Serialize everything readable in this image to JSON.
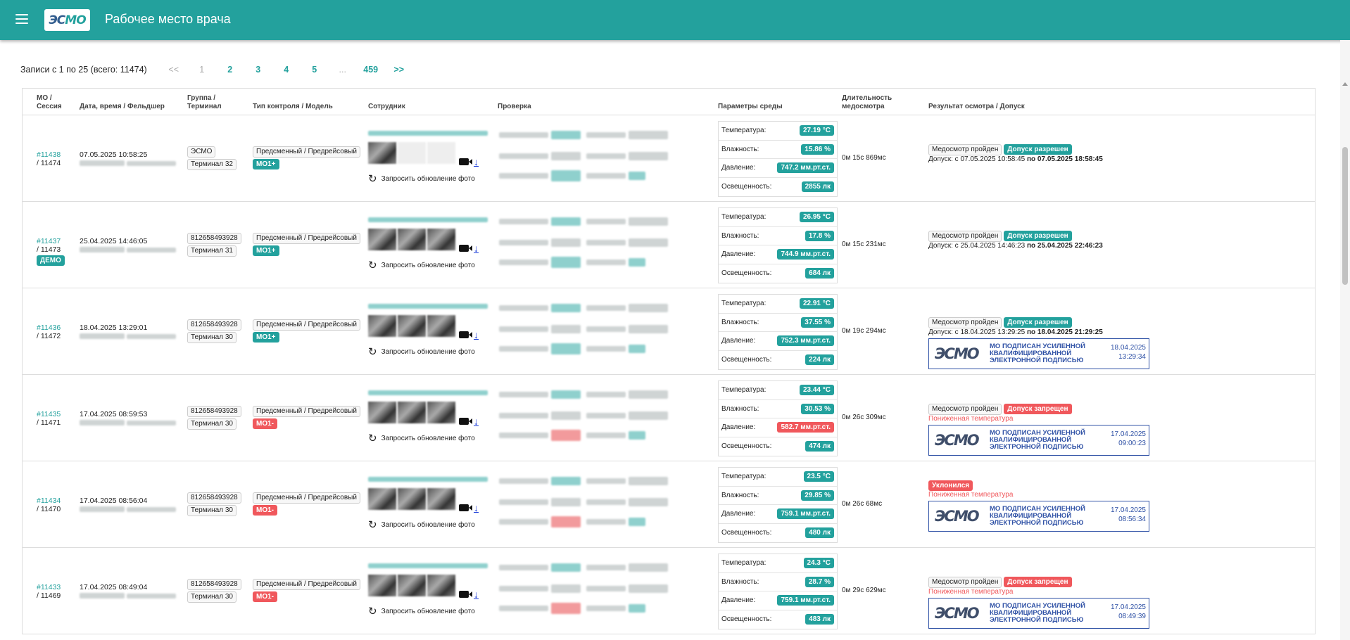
{
  "header": {
    "title": "Рабочее место врача",
    "logo": "ЭСМО"
  },
  "pagination": {
    "summary": "Записи с 1 по 25 (всего: 11474)",
    "prev": "<<",
    "pages": [
      "1",
      "2",
      "3",
      "4",
      "5",
      "...",
      "459"
    ],
    "next": ">>"
  },
  "columns": {
    "mo": "МО /\nСессия",
    "datetime": "Дата, время / Фельдшер",
    "group": "Группа /\nТерминал",
    "type": "Тип контроля / Модель",
    "employee": "Сотрудник",
    "check": "Проверка",
    "env": "Параметры среды",
    "duration": "Длительность\nмедосмотра",
    "result": "Результат осмотра / Допуск"
  },
  "labels": {
    "refresh": "Запросить обновление фото",
    "temp": "Температура:",
    "hum": "Влажность:",
    "press": "Давление:",
    "light": "Освещенность:",
    "stamp_text": "МО ПОДПИСАН УСИЛЕННОЙ КВАЛИФИЦИРОВАННОЙ ЭЛЕКТРОННОЙ ПОДПИСЬЮ"
  },
  "rows": [
    {
      "mo": "#11438",
      "session": "/ 11474",
      "demo": "",
      "datetime": "07.05.2025 10:58:25",
      "group": "ЭСМО",
      "terminal": "Терминал 32",
      "type": "Предсменный / Предрейсовый",
      "model": "МО1+",
      "model_red": false,
      "temp": "27.19 °C",
      "hum": "15.86 %",
      "press": "747.2 мм.рт.ст.",
      "press_red": false,
      "light": "2855 лк",
      "duration": "0м 15с 869мс",
      "status": "Медосмотр пройден",
      "admit": "Допуск разрешен",
      "admit_red": false,
      "reason": "",
      "period_from": "Допуск: с 07.05.2025 10:58:45 ",
      "period_to": "по 07.05.2025 18:58:45",
      "stamp_date": "",
      "stamp_time": ""
    },
    {
      "mo": "#11437",
      "session": "/ 11473",
      "demo": "ДЕМО",
      "datetime": "25.04.2025 14:46:05",
      "group": "812658493928",
      "terminal": "Терминал 31",
      "type": "Предсменный / Предрейсовый",
      "model": "МО1+",
      "model_red": false,
      "temp": "26.95 °C",
      "hum": "17.8 %",
      "press": "744.9 мм.рт.ст.",
      "press_red": false,
      "light": "684 лк",
      "duration": "0м 15с 231мс",
      "status": "Медосмотр пройден",
      "admit": "Допуск разрешен",
      "admit_red": false,
      "reason": "",
      "period_from": "Допуск: с 25.04.2025 14:46:23 ",
      "period_to": "по 25.04.2025 22:46:23",
      "stamp_date": "",
      "stamp_time": ""
    },
    {
      "mo": "#11436",
      "session": "/ 11472",
      "demo": "",
      "datetime": "18.04.2025 13:29:01",
      "group": "812658493928",
      "terminal": "Терминал 30",
      "type": "Предсменный / Предрейсовый",
      "model": "МО1+",
      "model_red": false,
      "temp": "22.91 °C",
      "hum": "37.55 %",
      "press": "752.3 мм.рт.ст.",
      "press_red": false,
      "light": "224 лк",
      "duration": "0м 19с 294мс",
      "status": "Медосмотр пройден",
      "admit": "Допуск разрешен",
      "admit_red": false,
      "reason": "",
      "period_from": "Допуск: с 18.04.2025 13:29:25 ",
      "period_to": "по 18.04.2025 21:29:25",
      "stamp_date": "18.04.2025",
      "stamp_time": "13:29:34"
    },
    {
      "mo": "#11435",
      "session": "/ 11471",
      "demo": "",
      "datetime": "17.04.2025 08:59:53",
      "group": "812658493928",
      "terminal": "Терминал 30",
      "type": "Предсменный / Предрейсовый",
      "model": "МО1-",
      "model_red": true,
      "temp": "23.44 °C",
      "hum": "30.53 %",
      "press": "582.7 мм.рт.ст.",
      "press_red": true,
      "light": "474 лк",
      "duration": "0м 26с 309мс",
      "status": "Медосмотр пройден",
      "admit": "Допуск запрещен",
      "admit_red": true,
      "reason": "Пониженная температура",
      "period_from": "",
      "period_to": "",
      "stamp_date": "17.04.2025",
      "stamp_time": "09:00:23"
    },
    {
      "mo": "#11434",
      "session": "/ 11470",
      "demo": "",
      "datetime": "17.04.2025 08:56:04",
      "group": "812658493928",
      "terminal": "Терминал 30",
      "type": "Предсменный / Предрейсовый",
      "model": "МО1-",
      "model_red": true,
      "temp": "23.5 °C",
      "hum": "29.85 %",
      "press": "759.1 мм.рт.ст.",
      "press_red": false,
      "light": "480 лк",
      "duration": "0м 26с 68мс",
      "status": "",
      "admit": "Уклонился",
      "admit_red": true,
      "reason": "Пониженная температура",
      "period_from": "",
      "period_to": "",
      "stamp_date": "17.04.2025",
      "stamp_time": "08:56:34"
    },
    {
      "mo": "#11433",
      "session": "/ 11469",
      "demo": "",
      "datetime": "17.04.2025 08:49:04",
      "group": "812658493928",
      "terminal": "Терминал 30",
      "type": "Предсменный / Предрейсовый",
      "model": "МО1-",
      "model_red": true,
      "temp": "24.3 °C",
      "hum": "28.7 %",
      "press": "759.1 мм.рт.ст.",
      "press_red": false,
      "light": "483 лк",
      "duration": "0м 29с 629мс",
      "status": "Медосмотр пройден",
      "admit": "Допуск запрещен",
      "admit_red": true,
      "reason": "Пониженная температура",
      "period_from": "",
      "period_to": "",
      "stamp_date": "17.04.2025",
      "stamp_time": "08:49:39"
    }
  ]
}
